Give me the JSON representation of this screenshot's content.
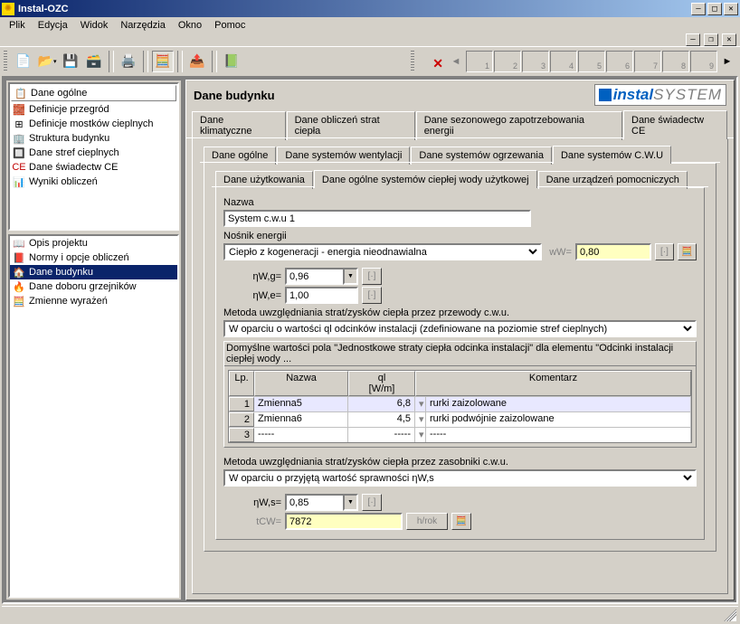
{
  "window": {
    "title": "Instal-OZC"
  },
  "menu": [
    "Plik",
    "Edycja",
    "Widok",
    "Narzędzia",
    "Okno",
    "Pomoc"
  ],
  "page_nav": {
    "pages": [
      "1",
      "2",
      "3",
      "4",
      "5",
      "6",
      "7",
      "8",
      "9"
    ]
  },
  "side_top": [
    {
      "icon": "📋",
      "label": "Dane ogólne",
      "box": true
    },
    {
      "icon": "🧱",
      "label": "Definicje przegród"
    },
    {
      "icon": "⊞",
      "label": "Definicje mostków cieplnych"
    },
    {
      "icon": "🏢",
      "label": "Struktura budynku"
    },
    {
      "icon": "🔲",
      "label": "Dane stref cieplnych"
    },
    {
      "icon": "CE",
      "label": "Dane świadectw CE",
      "iconcolor": "#c00000"
    },
    {
      "icon": "📊",
      "label": "Wyniki obliczeń"
    }
  ],
  "side_bottom": [
    {
      "icon": "📖",
      "label": "Opis projektu"
    },
    {
      "icon": "📕",
      "label": "Normy i opcje obliczeń"
    },
    {
      "icon": "🏠",
      "label": "Dane budynku",
      "sel": true
    },
    {
      "icon": "🔥",
      "label": "Dane doboru grzejników"
    },
    {
      "icon": "🧮",
      "label": "Zmienne wyrażeń"
    }
  ],
  "heading": "Dane budynku",
  "logo": {
    "t1": "instal",
    "t2": "SYSTEM"
  },
  "tabs1": [
    "Dane klimatyczne",
    "Dane obliczeń strat ciepła",
    "Dane sezonowego zapotrzebowania energii",
    "Dane świadectw CE"
  ],
  "tabs1_active": 3,
  "tabs2": [
    "Dane ogólne",
    "Dane systemów wentylacji",
    "Dane systemów ogrzewania",
    "Dane systemów C.W.U"
  ],
  "tabs2_active": 3,
  "tabs3": [
    "Dane użytkowania",
    "Dane ogólne systemów ciepłej wody użytkowej",
    "Dane urządzeń pomocniczych"
  ],
  "tabs3_active": 1,
  "form": {
    "nazwa_label": "Nazwa",
    "nazwa_value": "System c.w.u 1",
    "nosnik_label": "Nośnik energii",
    "nosnik_value": "Ciepło z kogeneracji - energia nieodnawialna",
    "wW_label": "wW=",
    "wW_value": "0,80",
    "etaWg_label": "ηW,g=",
    "etaWg_value": "0,96",
    "etaWe_label": "ηW,e=",
    "etaWe_value": "1,00",
    "method1_label": "Metoda uwzględniania strat/zysków ciepła przez przewody c.w.u.",
    "method1_value": "W oparciu o wartości ql odcinków instalacji (zdefiniowane na poziomie stref cieplnych)",
    "grouptitle": "Domyślne wartości pola \"Jednostkowe straty ciepła odcinka instalacji\" dla elementu \"Odcinki instalacji ciepłej wody ...",
    "cols": {
      "lp": "Lp.",
      "nazwa": "Nazwa",
      "q": "ql",
      "q_unit": "[W/m]",
      "kom": "Komentarz"
    },
    "rows": [
      {
        "lp": "1",
        "nazwa": "Zmienna5",
        "q": "6,8",
        "kom": "rurki zaizolowane"
      },
      {
        "lp": "2",
        "nazwa": "Zmienna6",
        "q": "4,5",
        "kom": "rurki podwójnie zaizolowane"
      },
      {
        "lp": "3",
        "nazwa": "-----",
        "q": "-----",
        "kom": "-----"
      }
    ],
    "method2_label": "Metoda uwzględniania strat/zysków ciepła przez zasobniki c.w.u.",
    "method2_value": "W oparciu o przyjętą wartość sprawności ηW,s",
    "etaWs_label": "ηW,s=",
    "etaWs_value": "0,85",
    "tcw_label": "tCW=",
    "tcw_value": "7872",
    "tcw_unit": "h/rok"
  }
}
